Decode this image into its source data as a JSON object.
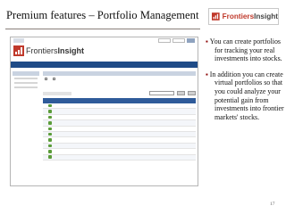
{
  "slide": {
    "title": "Premium features – Portfolio Management",
    "page_number": "17",
    "logo": {
      "word1": "Frontiers",
      "word2": "Insight"
    }
  },
  "bullets": [
    "You can create portfolios for tracking your real investments into stocks.",
    "In addition you can create virtual portfolios so that you could analyze your potential gain from investments into frontier markets' stocks."
  ],
  "colors": {
    "brand_red": "#c0392b",
    "nav_blue": "#1f4b87",
    "table_header": "#2f5b9a",
    "bullet_marker": "#8b0000"
  },
  "icons": {
    "logo": "frontiersinsight-logo-icon",
    "row": "portfolio-row-icon"
  }
}
